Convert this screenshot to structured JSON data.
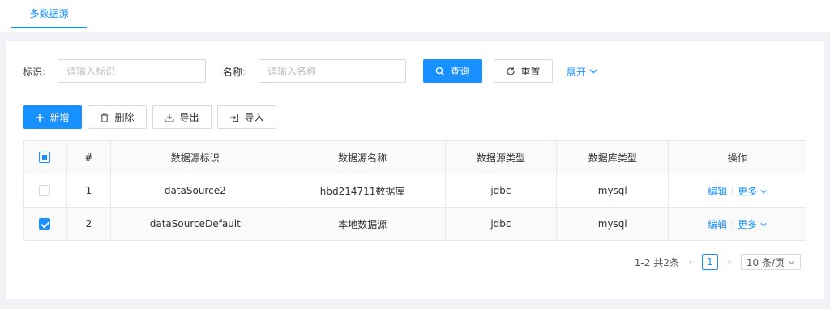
{
  "tabs": [
    {
      "label": "多数据源"
    }
  ],
  "filters": {
    "identifier": {
      "label": "标识:",
      "placeholder": "请输入标识"
    },
    "name": {
      "label": "名称:",
      "placeholder": "请输入名称"
    },
    "query_label": "查询",
    "reset_label": "重置",
    "expand_label": "展开"
  },
  "toolbar": {
    "add_label": "新增",
    "delete_label": "删除",
    "export_label": "导出",
    "import_label": "导入"
  },
  "table": {
    "columns": [
      "#",
      "数据源标识",
      "数据源名称",
      "数据源类型",
      "数据库类型",
      "操作"
    ],
    "rows": [
      {
        "index": "1",
        "id": "dataSource2",
        "name": "hbd214711数据库",
        "type": "jdbc",
        "db": "mysql",
        "checked": false
      },
      {
        "index": "2",
        "id": "dataSourceDefault",
        "name": "本地数据源",
        "type": "jdbc",
        "db": "mysql",
        "checked": true
      }
    ],
    "edit_label": "编辑",
    "more_label": "更多"
  },
  "pagination": {
    "summary": "1-2 共2条",
    "current_page": "1",
    "page_size": "10 条/页"
  },
  "colors": {
    "primary": "#1890ff",
    "border": "#d9d9d9"
  }
}
